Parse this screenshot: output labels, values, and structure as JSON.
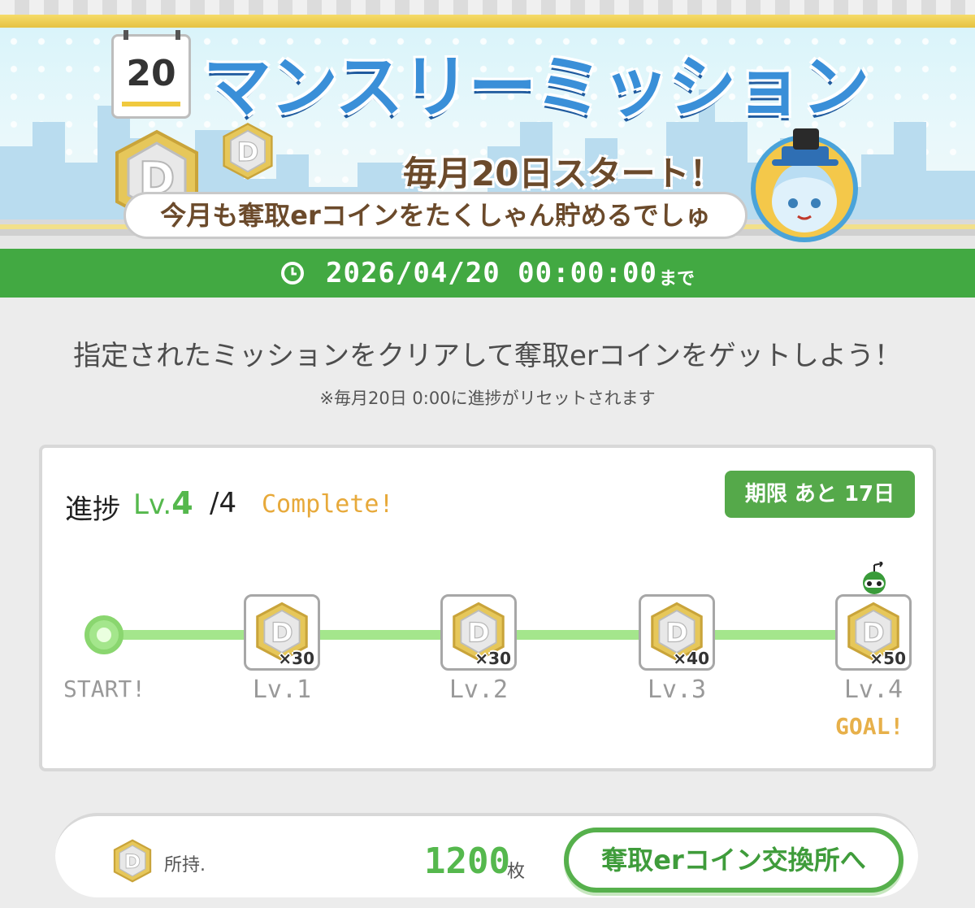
{
  "banner": {
    "calendar_day": "20",
    "title": "マンスリーミッション",
    "start_text": "毎月20日スタート！",
    "pill_text": "今月も奪取erコインをたくしゃん貯めるでしゅ",
    "coin_letter": "D"
  },
  "timer": {
    "icon": "clock-icon",
    "date": "2026/04/20 00:00:00",
    "suffix": "まで"
  },
  "description": {
    "main": "指定されたミッションをクリアして奪取erコインをゲットしよう！",
    "note": "※毎月20日 0:00に進捗がリセットされます"
  },
  "progress": {
    "label": "進捗",
    "level_prefix": "Lv.",
    "level_current": "4",
    "level_max": "/4",
    "status": "Complete!",
    "deadline": "期限 あと 17日",
    "start_label": "START!",
    "goal_label": "GOAL!",
    "nodes": [
      {
        "label": "Lv.1",
        "reward": "×30"
      },
      {
        "label": "Lv.2",
        "reward": "×30"
      },
      {
        "label": "Lv.3",
        "reward": "×40"
      },
      {
        "label": "Lv.4",
        "reward": "×50"
      }
    ]
  },
  "footer": {
    "hold_label": "所持.",
    "amount": "1200",
    "unit": "枚",
    "exchange_button": "奪取erコイン交換所へ"
  },
  "colors": {
    "accent_green": "#42a942",
    "level_green": "#55b84d",
    "complete_orange": "#e7a93a",
    "title_blue": "#3a8fd8"
  }
}
